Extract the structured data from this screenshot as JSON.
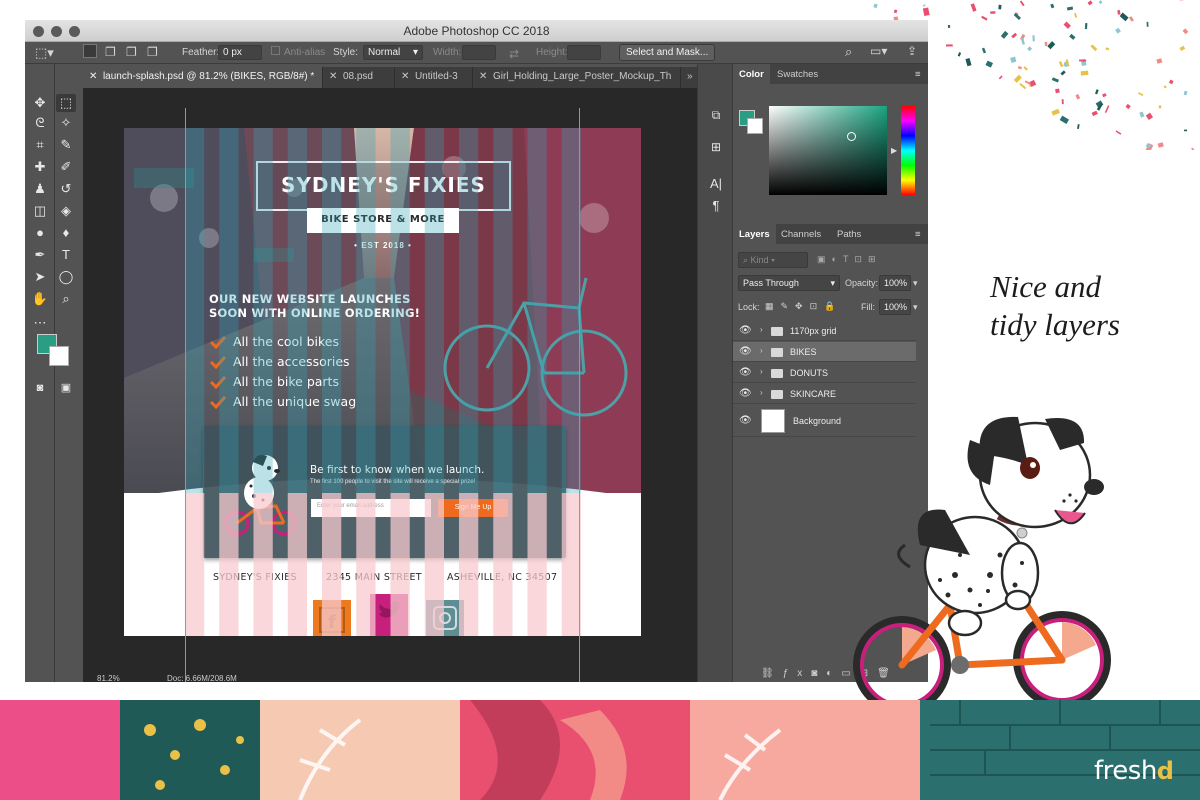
{
  "window": {
    "title": "Adobe Photoshop CC 2018"
  },
  "options_bar": {
    "feather_label": "Feather:",
    "feather_value": "0 px",
    "anti_alias_label": "Anti-alias",
    "style_label": "Style:",
    "style_value": "Normal",
    "width_label": "Width:",
    "height_label": "Height:",
    "select_mask_label": "Select and Mask..."
  },
  "tabs": [
    {
      "label": "launch-splash.psd @ 81.2% (BIKES, RGB/8#) *",
      "active": true
    },
    {
      "label": "08.psd",
      "active": false
    },
    {
      "label": "Untitled-3",
      "active": false
    },
    {
      "label": "Girl_Holding_Large_Poster_Mockup_Th",
      "active": false
    }
  ],
  "artwork": {
    "title": "SYDNEY'S FIXIES",
    "subtitle": "BIKE STORE & MORE",
    "est": "EST 2018",
    "headline_line1": "OUR NEW WEBSITE LAUNCHES",
    "headline_line2": "SOON WITH ONLINE ORDERING!",
    "features": [
      "All the cool bikes",
      "All the accessories",
      "All the bike parts",
      "All the unique swag"
    ],
    "signup_title": "Be first to know when we launch.",
    "signup_subtitle": "The first 100 people to visit the site will receive a special prize!",
    "email_placeholder": "Enter your email address",
    "signup_button": "Sign Me Up",
    "footer": [
      "SYDNEY'S FIXIES",
      "2345 MAIN STREET",
      "ASHEVILLE, NC 34507"
    ],
    "social_colors": {
      "facebook": "#ee7a20",
      "twitter": "#c81f7c",
      "instagram": "#5e8d94"
    }
  },
  "status": {
    "zoom": "81.2%",
    "doc": "Doc: 6.66M/208.6M"
  },
  "color_panel": {
    "tabs": [
      "Color",
      "Swatches"
    ],
    "foreground": "#2a9e84",
    "background": "#ffffff"
  },
  "layers_panel": {
    "tabs": [
      "Layers",
      "Channels",
      "Paths"
    ],
    "filter_label": "Kind",
    "blend_mode": "Pass Through",
    "opacity_label": "Opacity:",
    "opacity_value": "100%",
    "lock_label": "Lock:",
    "fill_label": "Fill:",
    "fill_value": "100%",
    "layers": [
      {
        "name": "1170px grid",
        "type": "group",
        "selected": false
      },
      {
        "name": "BIKES",
        "type": "group",
        "selected": true
      },
      {
        "name": "DONUTS",
        "type": "group",
        "selected": false
      },
      {
        "name": "SKINCARE",
        "type": "group",
        "selected": false
      },
      {
        "name": "Background",
        "type": "layer",
        "selected": false
      }
    ]
  },
  "caption": {
    "line1": "Nice and",
    "line2": "tidy layers"
  },
  "brand": {
    "name": "fresh",
    "mark": "d"
  },
  "colors": {
    "accent_orange": "#ed6a1f",
    "teal_panel": "#3f545c",
    "grid_teal": "#2ea6b8",
    "grid_pink": "#f7c9cf"
  }
}
